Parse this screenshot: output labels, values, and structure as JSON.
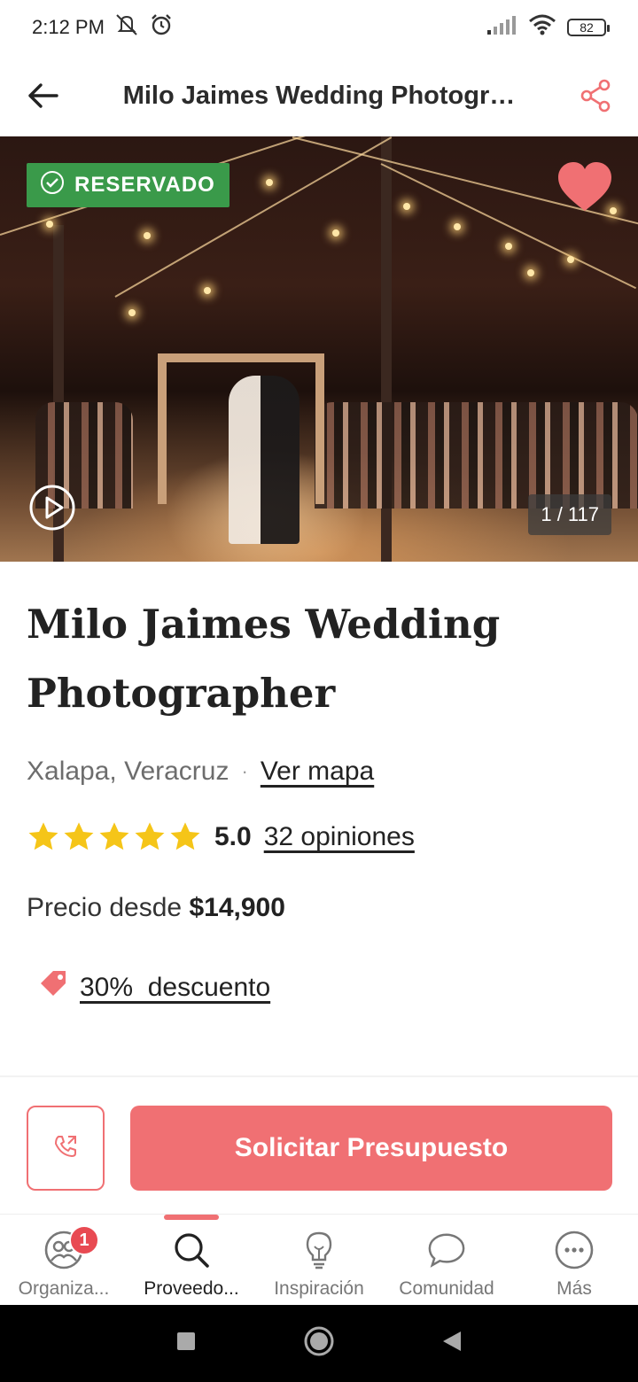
{
  "status_bar": {
    "time": "2:12 PM",
    "battery": "82",
    "icons": [
      "mute-icon",
      "alarm-icon",
      "signal-icon",
      "wifi-icon",
      "battery-icon"
    ]
  },
  "app_bar": {
    "title": "Milo Jaimes Wedding Photogr…",
    "back_icon": "back-arrow-icon",
    "share_icon": "share-icon"
  },
  "hero": {
    "badge": "RESERVADO",
    "counter": "1 / 117",
    "favorite": true
  },
  "vendor": {
    "name": "Milo Jaimes Wedding Photographer",
    "location": "Xalapa, Veracruz",
    "separator": "·",
    "map_link": "Ver mapa",
    "stars": 5,
    "rating": "5.0",
    "reviews": "32 opiniones",
    "price_label": "Precio desde",
    "price_value": "$14,900",
    "discount": "30%  descuento"
  },
  "actions": {
    "quote_button": "Solicitar Presupuesto",
    "call_icon": "phone-call-icon"
  },
  "bottom_nav": {
    "items": [
      {
        "label": "Organiza...",
        "icon": "organizer-icon",
        "badge": "1"
      },
      {
        "label": "Proveedo...",
        "icon": "search-icon",
        "active": true
      },
      {
        "label": "Inspiración",
        "icon": "lightbulb-icon"
      },
      {
        "label": "Comunidad",
        "icon": "chat-bubble-icon"
      },
      {
        "label": "Más",
        "icon": "more-icon"
      }
    ]
  },
  "colors": {
    "accent": "#f07073",
    "reserved_green": "#3a9a4a",
    "star": "#f5c518",
    "badge_red": "#e84a52"
  }
}
